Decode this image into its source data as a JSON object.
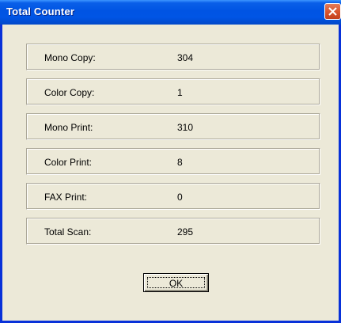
{
  "window": {
    "title": "Total Counter",
    "close_icon": "close-icon"
  },
  "counters": [
    {
      "label": "Mono Copy:",
      "value": "304"
    },
    {
      "label": "Color Copy:",
      "value": "1"
    },
    {
      "label": "Mono Print:",
      "value": "310"
    },
    {
      "label": "Color Print:",
      "value": "8"
    },
    {
      "label": "FAX Print:",
      "value": "0"
    },
    {
      "label": "Total Scan:",
      "value": "295"
    }
  ],
  "buttons": {
    "ok_label": "OK"
  },
  "colors": {
    "titlebar": "#0054e3",
    "dialog_background": "#ece9d8",
    "close_button": "#d9562f"
  }
}
